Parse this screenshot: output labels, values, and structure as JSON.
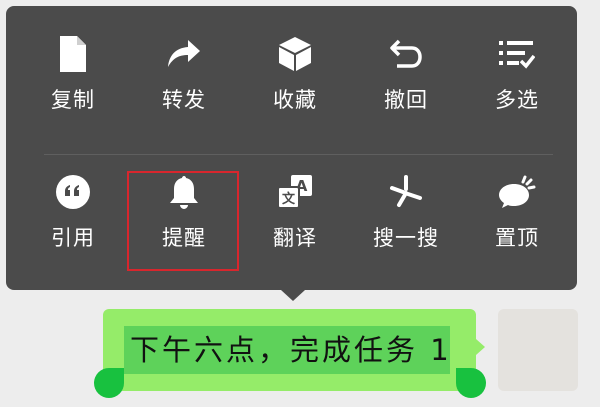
{
  "context_menu": {
    "row1": [
      {
        "label": "复制",
        "icon": "copy-icon"
      },
      {
        "label": "转发",
        "icon": "forward-icon"
      },
      {
        "label": "收藏",
        "icon": "favorite-box-icon"
      },
      {
        "label": "撤回",
        "icon": "undo-icon"
      },
      {
        "label": "多选",
        "icon": "multi-select-icon"
      }
    ],
    "row2": [
      {
        "label": "引用",
        "icon": "quote-icon"
      },
      {
        "label": "提醒",
        "icon": "bell-icon"
      },
      {
        "label": "翻译",
        "icon": "translate-icon"
      },
      {
        "label": "搜一搜",
        "icon": "search-sparkle-icon"
      },
      {
        "label": "置顶",
        "icon": "pin-top-icon"
      }
    ],
    "highlighted_item": "提醒"
  },
  "message": {
    "text": "下午六点，完成任务 1"
  },
  "colors": {
    "menu_bg": "#4b4b4b",
    "bubble": "#95ec69",
    "selection": "#5ed25a",
    "handle": "#18c13f",
    "highlight_border": "#d8262d",
    "page_bg": "#ededed"
  }
}
